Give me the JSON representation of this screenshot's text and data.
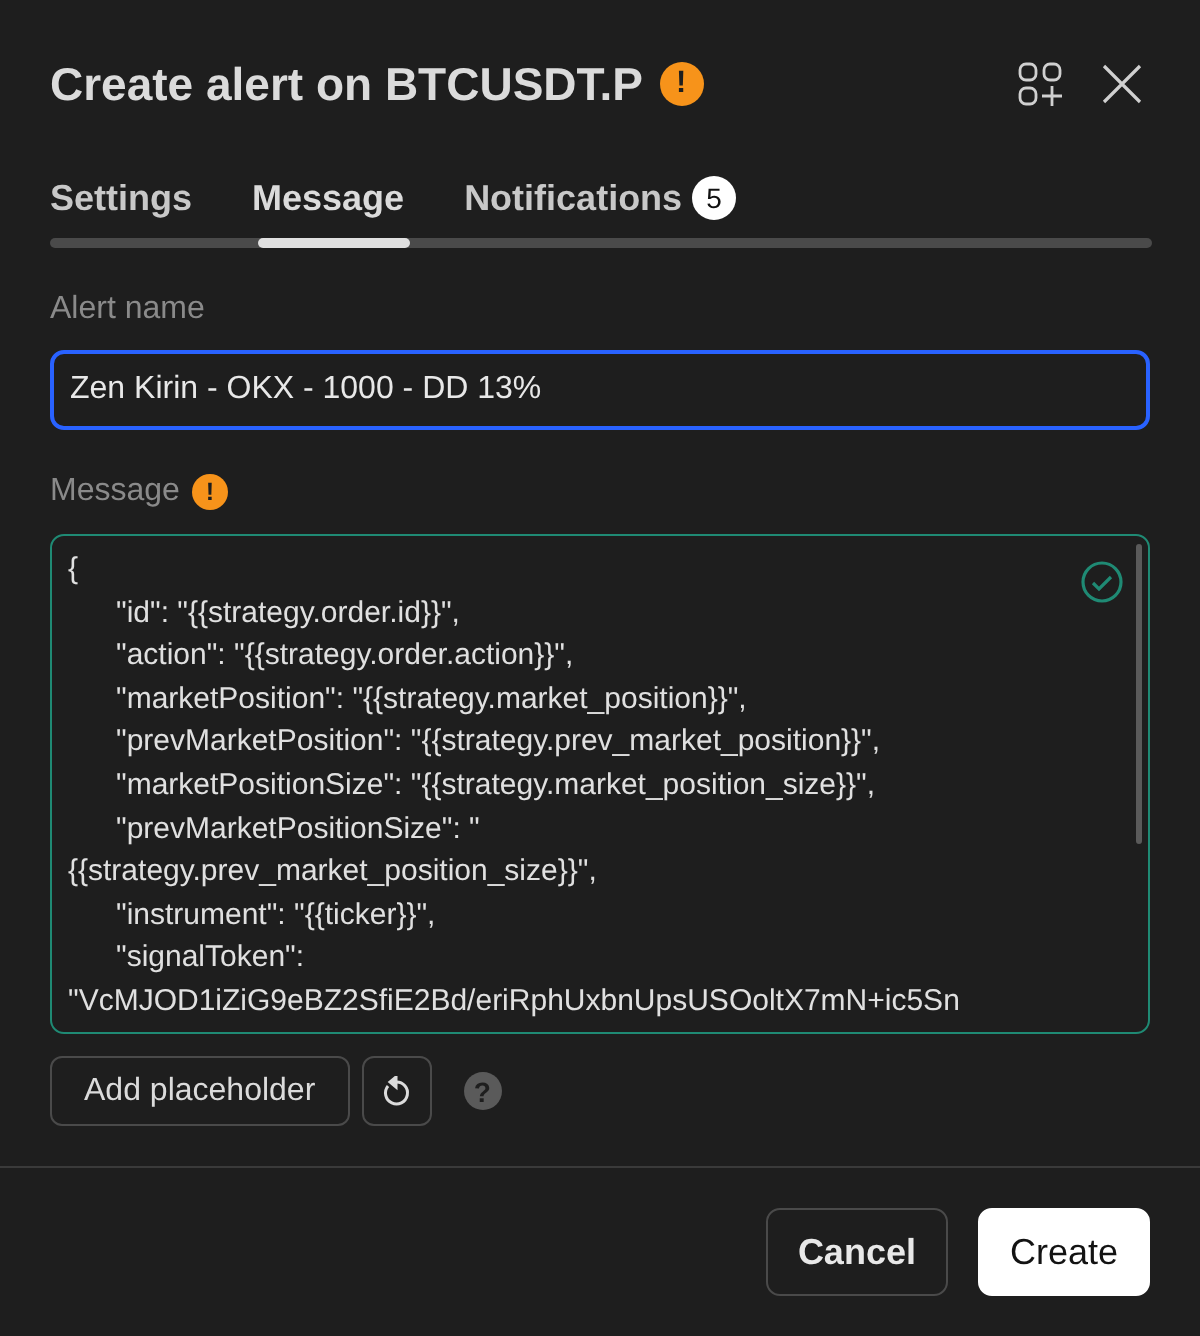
{
  "dialog": {
    "title": "Create alert on BTCUSDT.P",
    "title_warning": "!"
  },
  "tabs": [
    {
      "label": "Settings",
      "selected": false
    },
    {
      "label": "Message",
      "selected": true
    },
    {
      "label": "Notifications",
      "selected": false,
      "badge": "5"
    }
  ],
  "alert_name": {
    "label": "Alert name",
    "value": "Zen Kirin - OKX - 1000 - DD 13%",
    "focused": true
  },
  "message": {
    "label": "Message",
    "warning": "!",
    "valid": true,
    "lines": [
      {
        "text": "{",
        "indent": false
      },
      {
        "text": "\"id\": \"{{strategy.order.id}}\",",
        "indent": true
      },
      {
        "text": "\"action\": \"{{strategy.order.action}}\",",
        "indent": true
      },
      {
        "text": "\"marketPosition\": \"{{strategy.market_position}}\",",
        "indent": true
      },
      {
        "text": "\"prevMarketPosition\": \"{{strategy.prev_market_position}}\",",
        "indent": true
      },
      {
        "text": "\"marketPositionSize\": \"{{strategy.market_position_size}}\",",
        "indent": true
      },
      {
        "text": "\"prevMarketPositionSize\": \"",
        "indent": true
      },
      {
        "text": "{{strategy.prev_market_position_size}}\",",
        "indent": false
      },
      {
        "text": "\"instrument\": \"{{ticker}}\",",
        "indent": true
      },
      {
        "text": "\"signalToken\":",
        "indent": true
      },
      {
        "text": "\"VcMJOD1iZiG9eBZ2SfiE2Bd/eriRphUxbnUpsUSOoltX7mN+ic5Sn",
        "indent": false
      }
    ]
  },
  "tools": {
    "add_placeholder": "Add placeholder",
    "help": "?"
  },
  "footer": {
    "buttons": [
      {
        "label": "Cancel",
        "kind": "secondary"
      },
      {
        "label": "Create",
        "kind": "primary"
      }
    ]
  }
}
